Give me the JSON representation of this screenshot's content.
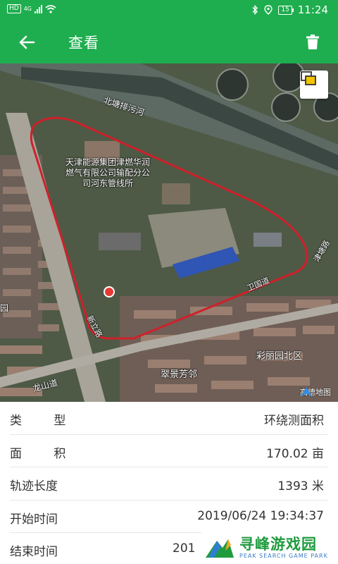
{
  "status_bar": {
    "network_badge": "HD",
    "network_type": "4G",
    "battery": "15",
    "time": "11:24"
  },
  "app_bar": {
    "title": "查看",
    "back_icon": "arrow-left-icon",
    "delete_icon": "trash-icon"
  },
  "map": {
    "labels": {
      "river": "北塘排污河",
      "company": "天津能源集团津燃华润燃气有限公司输配分公司河东管线所",
      "road_1": "卫国道",
      "road_2": "津塘路",
      "road_3": "新立路",
      "road_4": "龙山道",
      "area_1": "彩丽园北区",
      "area_2": "翠景芳邻",
      "area_3": "园"
    },
    "logo": "高德地图",
    "layer_icon": "layers-icon",
    "poi_icon": "gas-station-icon",
    "track_color": "#d0202a"
  },
  "info": [
    {
      "label": "类 型",
      "value": "环绕测面积"
    },
    {
      "label": "面 积",
      "value": "170.02 亩"
    },
    {
      "label": "轨迹长度",
      "value": "1393 米"
    },
    {
      "label": "开始时间",
      "value": "2019/06/24 19:34:37"
    },
    {
      "label": "结束时间",
      "value": "201"
    }
  ],
  "watermark": {
    "main": "寻峰游戏园",
    "sub": "PEAK SEARCH GAME PARK"
  },
  "colors": {
    "primary": "#1fae4f",
    "text": "#333333",
    "divider": "#e6e6e6"
  }
}
